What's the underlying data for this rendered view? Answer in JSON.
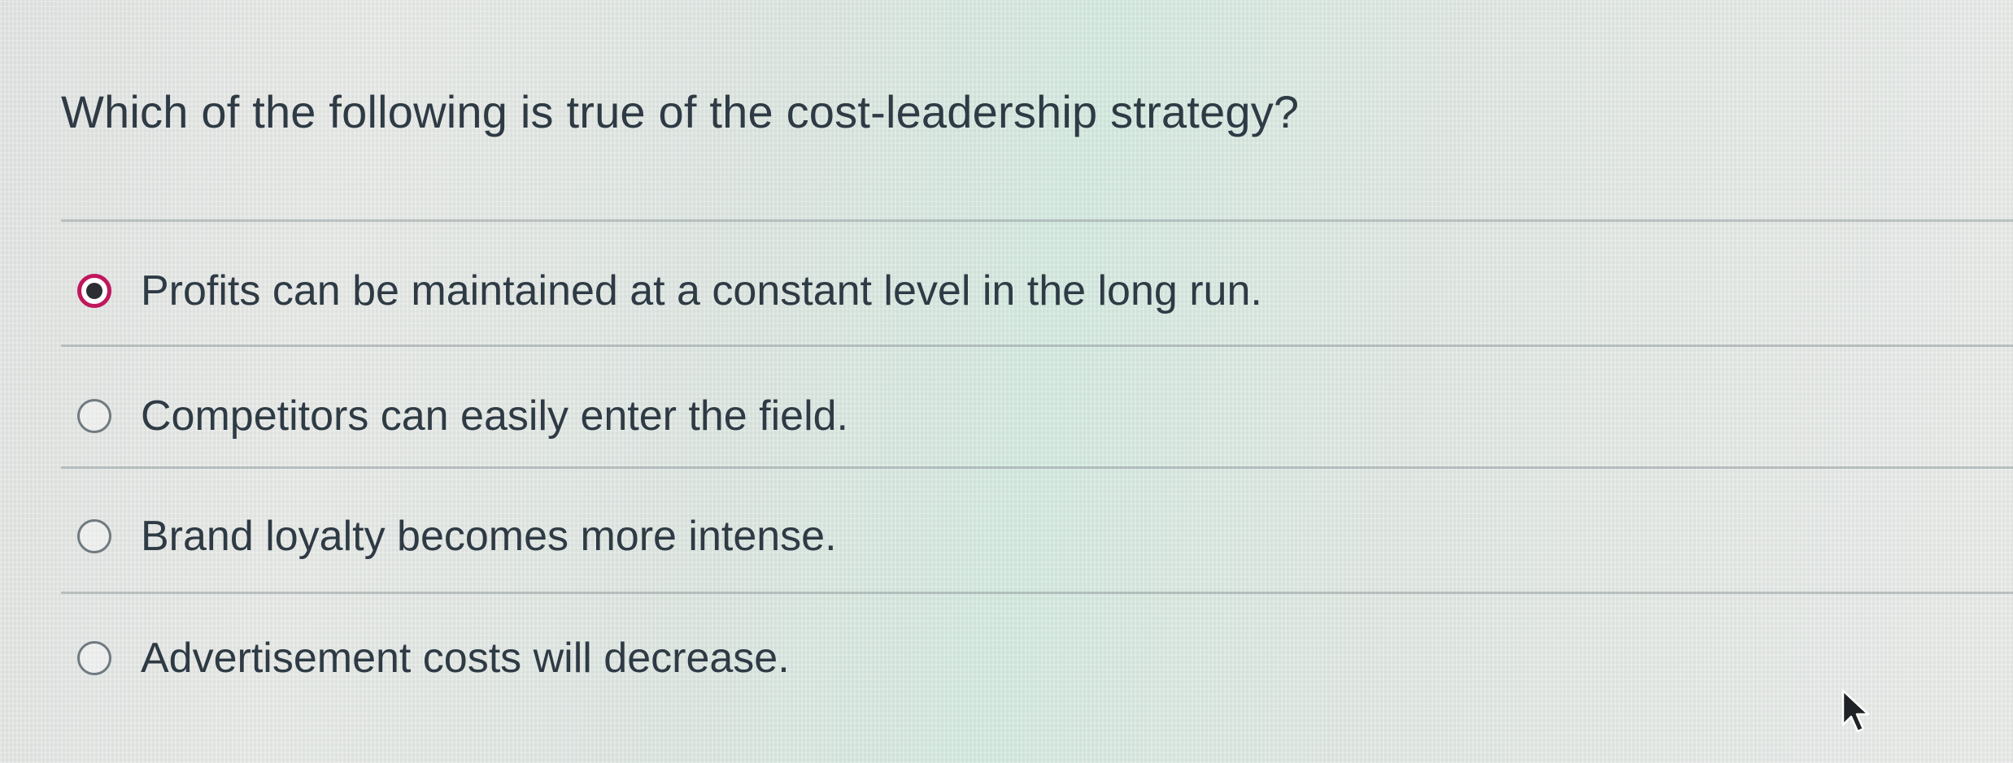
{
  "question": {
    "text": "Which of the following is true of the cost-leadership strategy?"
  },
  "answers": [
    {
      "label": "Profits can be maintained at a constant level in the long run.",
      "selected": true
    },
    {
      "label": "Competitors can easily enter the field.",
      "selected": false
    },
    {
      "label": "Brand loyalty becomes more intense.",
      "selected": false
    },
    {
      "label": "Advertisement costs will decrease.",
      "selected": false
    }
  ],
  "colors": {
    "selected_radio_ring": "#c0175d",
    "text": "#2e3a44"
  },
  "icons": {
    "cursor": "mouse-pointer-icon"
  }
}
